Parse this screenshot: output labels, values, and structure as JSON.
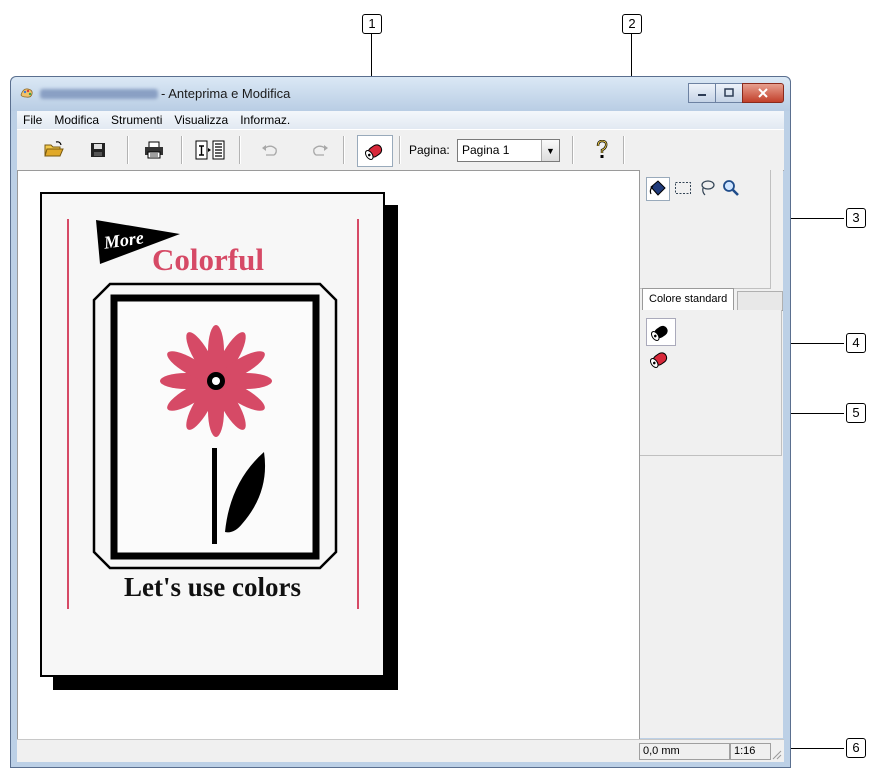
{
  "window": {
    "title": "- Anteprima e Modifica"
  },
  "menu": [
    "File",
    "Modifica",
    "Strumenti",
    "Visualizza",
    "Informaz."
  ],
  "toolbar": {
    "page_label": "Pagina:",
    "page_value": "Pagina 1",
    "icons": [
      "open-folder-icon",
      "save-icon",
      "print-icon",
      "page-layout-icon",
      "undo-icon",
      "redo-icon",
      "color-roller-icon",
      "help-icon"
    ]
  },
  "side_panel": {
    "tools": [
      "fill-bucket-icon",
      "rectangle-select-icon",
      "lasso-icon",
      "zoom-icon"
    ],
    "tab_label": "Colore standard",
    "colors": [
      {
        "name": "black-ink-icon",
        "color": "#000000"
      },
      {
        "name": "red-ink-icon",
        "color": "#d8283a"
      }
    ]
  },
  "document": {
    "badge_text": "More",
    "headline": "Colorful",
    "tagline": "Let's use colors",
    "accent_color": "#d64a66"
  },
  "status": {
    "position": "0,0 mm",
    "zoom": "1:16"
  },
  "callouts": [
    "1",
    "2",
    "3",
    "4",
    "5",
    "6"
  ]
}
